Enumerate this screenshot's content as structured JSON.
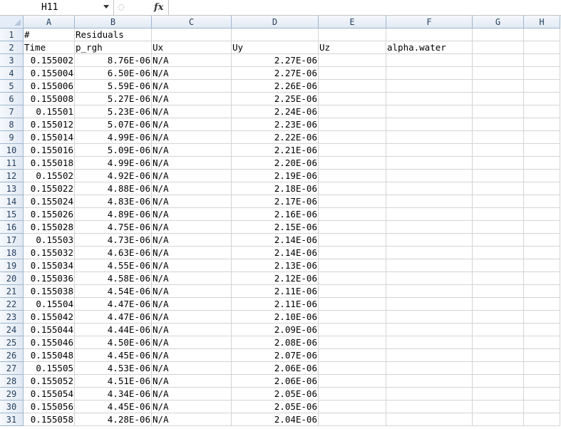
{
  "formula_bar": {
    "name_box": "H11",
    "fx_label": "fx",
    "formula": ""
  },
  "columns": [
    "A",
    "B",
    "C",
    "D",
    "E",
    "F",
    "G",
    "H"
  ],
  "row_numbers": [
    "1",
    "2",
    "3",
    "4",
    "5",
    "6",
    "7",
    "8",
    "9",
    "10",
    "11",
    "12",
    "13",
    "14",
    "15",
    "16",
    "17",
    "18",
    "19",
    "20",
    "21",
    "22",
    "23",
    "24",
    "25",
    "26",
    "27",
    "28",
    "29",
    "30",
    "31"
  ],
  "rows": [
    [
      "#",
      "Residuals",
      "",
      "",
      "",
      "",
      "",
      ""
    ],
    [
      "Time",
      "p_rgh",
      "Ux",
      "Uy",
      "Uz",
      "alpha.water",
      "",
      ""
    ],
    [
      "0.155002",
      "8.76E-06",
      "N/A",
      "2.27E-06",
      "",
      "",
      "",
      ""
    ],
    [
      "0.155004",
      "6.50E-06",
      "N/A",
      "2.27E-06",
      "",
      "",
      "",
      ""
    ],
    [
      "0.155006",
      "5.59E-06",
      "N/A",
      "2.26E-06",
      "",
      "",
      "",
      ""
    ],
    [
      "0.155008",
      "5.27E-06",
      "N/A",
      "2.25E-06",
      "",
      "",
      "",
      ""
    ],
    [
      "0.15501",
      "5.23E-06",
      "N/A",
      "2.24E-06",
      "",
      "",
      "",
      ""
    ],
    [
      "0.155012",
      "5.07E-06",
      "N/A",
      "2.23E-06",
      "",
      "",
      "",
      ""
    ],
    [
      "0.155014",
      "4.99E-06",
      "N/A",
      "2.22E-06",
      "",
      "",
      "",
      ""
    ],
    [
      "0.155016",
      "5.09E-06",
      "N/A",
      "2.21E-06",
      "",
      "",
      "",
      ""
    ],
    [
      "0.155018",
      "4.99E-06",
      "N/A",
      "2.20E-06",
      "",
      "",
      "",
      ""
    ],
    [
      "0.15502",
      "4.92E-06",
      "N/A",
      "2.19E-06",
      "",
      "",
      "",
      ""
    ],
    [
      "0.155022",
      "4.88E-06",
      "N/A",
      "2.18E-06",
      "",
      "",
      "",
      ""
    ],
    [
      "0.155024",
      "4.83E-06",
      "N/A",
      "2.17E-06",
      "",
      "",
      "",
      ""
    ],
    [
      "0.155026",
      "4.89E-06",
      "N/A",
      "2.16E-06",
      "",
      "",
      "",
      ""
    ],
    [
      "0.155028",
      "4.75E-06",
      "N/A",
      "2.15E-06",
      "",
      "",
      "",
      ""
    ],
    [
      "0.15503",
      "4.73E-06",
      "N/A",
      "2.14E-06",
      "",
      "",
      "",
      ""
    ],
    [
      "0.155032",
      "4.63E-06",
      "N/A",
      "2.14E-06",
      "",
      "",
      "",
      ""
    ],
    [
      "0.155034",
      "4.55E-06",
      "N/A",
      "2.13E-06",
      "",
      "",
      "",
      ""
    ],
    [
      "0.155036",
      "4.58E-06",
      "N/A",
      "2.12E-06",
      "",
      "",
      "",
      ""
    ],
    [
      "0.155038",
      "4.54E-06",
      "N/A",
      "2.11E-06",
      "",
      "",
      "",
      ""
    ],
    [
      "0.15504",
      "4.47E-06",
      "N/A",
      "2.11E-06",
      "",
      "",
      "",
      ""
    ],
    [
      "0.155042",
      "4.47E-06",
      "N/A",
      "2.10E-06",
      "",
      "",
      "",
      ""
    ],
    [
      "0.155044",
      "4.44E-06",
      "N/A",
      "2.09E-06",
      "",
      "",
      "",
      ""
    ],
    [
      "0.155046",
      "4.50E-06",
      "N/A",
      "2.08E-06",
      "",
      "",
      "",
      ""
    ],
    [
      "0.155048",
      "4.45E-06",
      "N/A",
      "2.07E-06",
      "",
      "",
      "",
      ""
    ],
    [
      "0.15505",
      "4.53E-06",
      "N/A",
      "2.06E-06",
      "",
      "",
      "",
      ""
    ],
    [
      "0.155052",
      "4.51E-06",
      "N/A",
      "2.06E-06",
      "",
      "",
      "",
      ""
    ],
    [
      "0.155054",
      "4.34E-06",
      "N/A",
      "2.05E-06",
      "",
      "",
      "",
      ""
    ],
    [
      "0.155056",
      "4.45E-06",
      "N/A",
      "2.05E-06",
      "",
      "",
      "",
      ""
    ],
    [
      "0.155058",
      "4.28E-06",
      "N/A",
      "2.04E-06",
      "",
      "",
      "",
      ""
    ]
  ]
}
